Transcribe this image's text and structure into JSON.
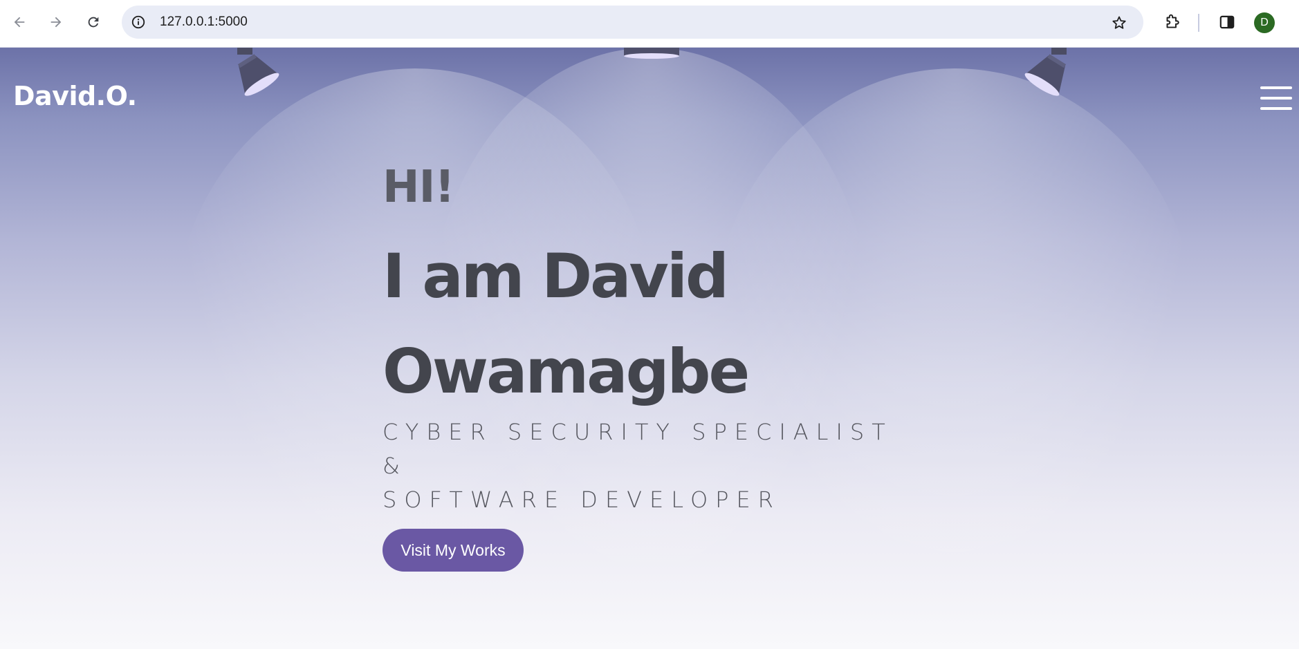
{
  "browser": {
    "url": "127.0.0.1:5000",
    "profile_initial": "D",
    "profile_color": "#2b6a23",
    "icons": {
      "back": "arrow-left-icon",
      "forward": "arrow-right-icon",
      "reload": "reload-icon",
      "site_info": "info-icon",
      "bookmark": "star-icon",
      "extensions": "puzzle-icon",
      "side_panel": "side-panel-icon"
    }
  },
  "site": {
    "logo": "David.O.",
    "menu_icon": "hamburger-menu-icon",
    "hero": {
      "greeting": "HI!",
      "name_line1": "I am David",
      "name_line2": "Owamagbe",
      "subtitle_line1": "CYBER SECURITY SPECIALIST &",
      "subtitle_line2": "SOFTWARE DEVELOPER",
      "cta_label": "Visit My Works"
    },
    "colors": {
      "accent": "#6a58a4",
      "heading": "#43454d",
      "background_top": "#6c72a8",
      "background_bottom": "#f8f8fb"
    },
    "decorations": [
      "spotlight-lamp-icon",
      "spotlight-lamp-icon",
      "spotlight-lamp-icon"
    ]
  }
}
